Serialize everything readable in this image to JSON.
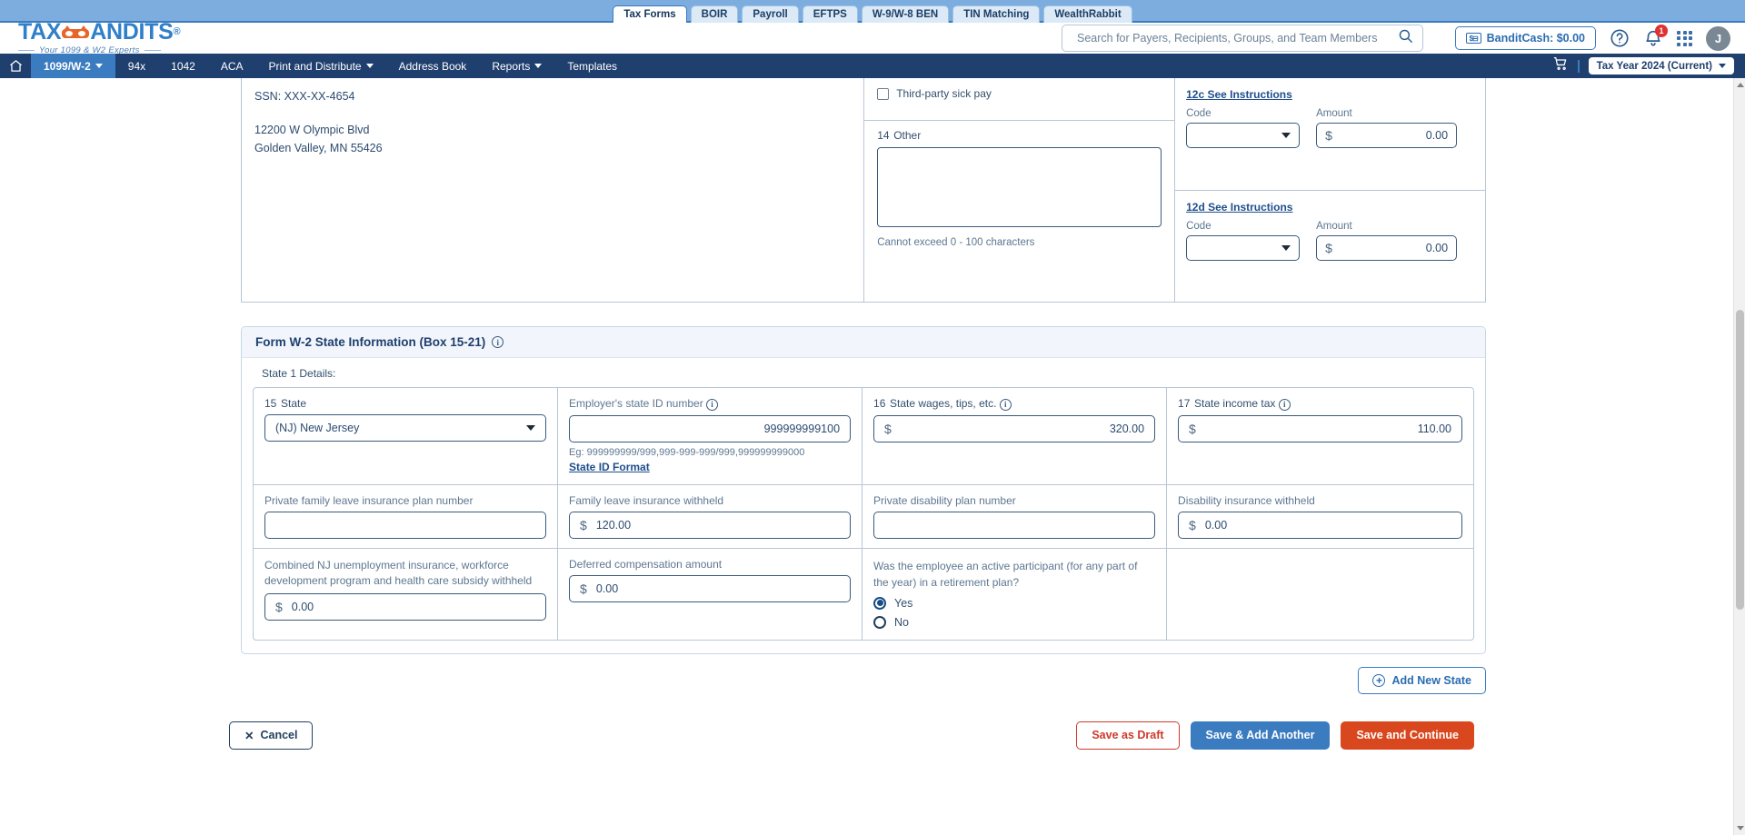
{
  "top_tabs": [
    {
      "label": "Tax Forms",
      "active": true
    },
    {
      "label": "BOIR",
      "active": false
    },
    {
      "label": "Payroll",
      "active": false
    },
    {
      "label": "EFTPS",
      "active": false
    },
    {
      "label": "W-9/W-8 BEN",
      "active": false
    },
    {
      "label": "TIN Matching",
      "active": false
    },
    {
      "label": "WealthRabbit",
      "active": false
    }
  ],
  "brand": {
    "name_part1": "TAX",
    "name_part2": "ANDITS",
    "registered": "®",
    "tagline": "Your 1099 & W2 Experts"
  },
  "search": {
    "placeholder": "Search for Payers, Recipients, Groups, and Team Members",
    "value": ""
  },
  "header": {
    "banditcash_label": "BanditCash: $0.00",
    "cash_glyph": "$",
    "help_icon": "question-mark-circle-icon",
    "notification_count": "1",
    "avatar_initial": "J"
  },
  "nav": {
    "items": [
      {
        "label": "1099/W-2",
        "caret": true,
        "active": true
      },
      {
        "label": "94x",
        "caret": false,
        "active": false
      },
      {
        "label": "1042",
        "caret": false,
        "active": false
      },
      {
        "label": "ACA",
        "caret": false,
        "active": false
      },
      {
        "label": "Print and Distribute",
        "caret": true,
        "active": false
      },
      {
        "label": "Address Book",
        "caret": false,
        "active": false
      },
      {
        "label": "Reports",
        "caret": true,
        "active": false
      },
      {
        "label": "Templates",
        "caret": false,
        "active": false
      }
    ],
    "tax_year": "Tax Year 2024 (Current)"
  },
  "employee": {
    "ssn_line": "SSN: XXX-XX-4654",
    "address_line1": "12200 W Olympic Blvd",
    "address_line2": "Golden Valley, MN 55426"
  },
  "box13": {
    "third_party_sick_pay": "Third-party sick pay",
    "checked": false
  },
  "box14": {
    "number": "14",
    "label": "Other",
    "value": "",
    "hint": "Cannot exceed 0 - 100 characters"
  },
  "box12": [
    {
      "link": "12c See Instructions",
      "code_label": "Code",
      "code_value": "",
      "amount_label": "Amount",
      "amount_value": "0.00",
      "currency": "$"
    },
    {
      "link": "12d See Instructions",
      "code_label": "Code",
      "code_value": "",
      "amount_label": "Amount",
      "amount_value": "0.00",
      "currency": "$"
    }
  ],
  "state_section": {
    "title": "Form W-2 State Information (Box 15-21)",
    "detail_label": "State 1 Details:",
    "fields": {
      "state_num": "15",
      "state_label": "State",
      "state_value": "(NJ) New Jersey",
      "employer_state_id_label": "Employer's state ID number",
      "employer_state_id_value": "999999999100",
      "employer_state_id_eg": "Eg: 999999999/999,999-999-999/999,999999999000",
      "state_id_format_link": "State ID Format",
      "state_wages_num": "16",
      "state_wages_label": "State wages, tips, etc.",
      "state_wages_value": "320.00",
      "state_income_tax_num": "17",
      "state_income_tax_label": "State income tax",
      "state_income_tax_value": "110.00",
      "private_family_leave_label": "Private family leave insurance plan number",
      "private_family_leave_value": "",
      "family_leave_withheld_label": "Family leave insurance withheld",
      "family_leave_withheld_value": "120.00",
      "private_disability_label": "Private disability plan number",
      "private_disability_value": "",
      "disability_withheld_label": "Disability insurance withheld",
      "disability_withheld_value": "0.00",
      "combined_nj_label": "Combined NJ unemployment insurance, workforce development program and health care subsidy withheld",
      "combined_nj_value": "0.00",
      "deferred_comp_label": "Deferred compensation amount",
      "deferred_comp_value": "0.00",
      "retirement_question": "Was the employee an active participant (for any part of the year) in a retirement plan?",
      "retirement_yes": "Yes",
      "retirement_no": "No",
      "retirement_selected": "Yes",
      "currency": "$"
    },
    "add_new_state": "Add New State"
  },
  "footer": {
    "cancel": "Cancel",
    "save_as_draft": "Save as Draft",
    "save_add_another": "Save & Add Another",
    "save_and_continue": "Save and Continue"
  },
  "colors": {
    "nav_bg": "#1f3f6e",
    "accent_blue": "#3b7bbf",
    "orange": "#d8471d",
    "red": "#cf3a2a",
    "badge_red": "#e03131"
  }
}
